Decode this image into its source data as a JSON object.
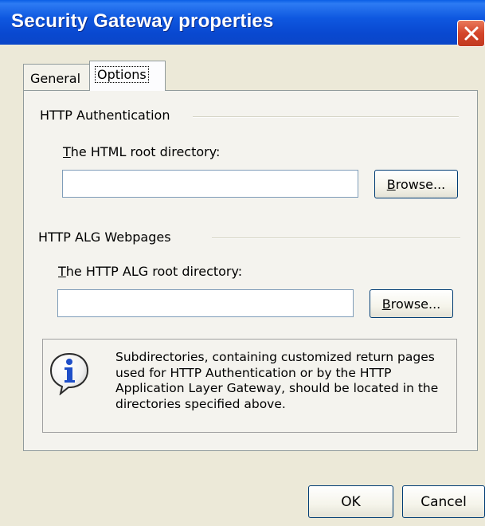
{
  "window": {
    "title": "Security Gateway properties"
  },
  "tabs": [
    {
      "label": "General",
      "active": false
    },
    {
      "label": "Options",
      "active": true
    }
  ],
  "http_authentication": {
    "heading": "HTTP Authentication",
    "label_mnemonic": "T",
    "label_rest": "he HTML root directory:",
    "input_value": "",
    "browse_mnemonic": "B",
    "browse_rest": "rowse..."
  },
  "http_alg": {
    "heading": "HTTP ALG Webpages",
    "label_mnemonic": "T",
    "label_rest": "he HTTP ALG root directory:",
    "input_value": "",
    "browse_mnemonic": "B",
    "browse_rest": "rowse..."
  },
  "info": {
    "icon": "info-icon",
    "text": "Subdirectories, containing customized return pages used for HTTP Authentication or by the HTTP Application Layer Gateway, should be located in the directories specified above."
  },
  "buttons": {
    "ok": "OK",
    "cancel": "Cancel"
  },
  "colors": {
    "titlebar": "#0A4FD8",
    "dialog_bg": "#ECE9D8",
    "close_button": "#D4452A",
    "button_border": "#003C74"
  }
}
